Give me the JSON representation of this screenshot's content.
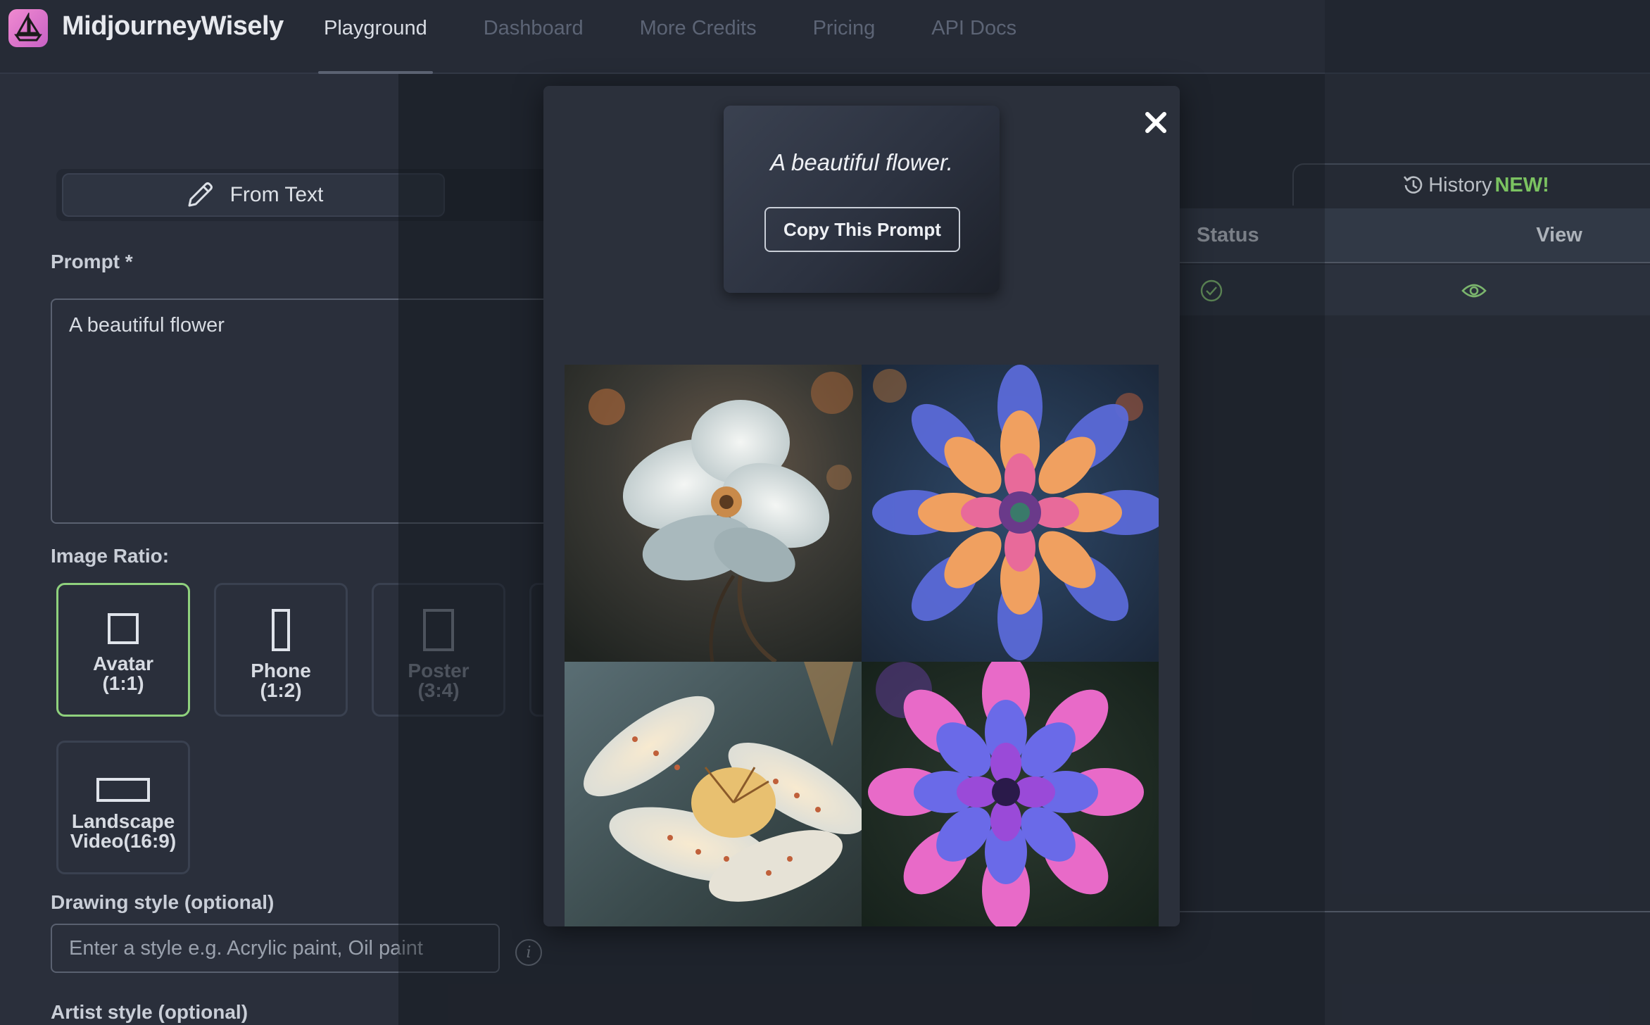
{
  "app": {
    "brand": "MidjourneyWisely",
    "nav": [
      "Playground",
      "Dashboard",
      "More Credits",
      "Pricing",
      "API Docs"
    ],
    "active_nav": "Playground"
  },
  "form": {
    "tab_label": "From Text",
    "prompt_label": "Prompt *",
    "prompt_value": "A beautiful flower",
    "ratio_label": "Image Ratio:",
    "ratios": [
      {
        "name": "Avatar",
        "ratio": "(1:1)",
        "selected": true
      },
      {
        "name": "Phone",
        "ratio": "(1:2)",
        "selected": false
      },
      {
        "name": "Poster",
        "ratio": "(3:4)",
        "selected": false
      },
      {
        "name": "Landscape",
        "ratio": "Video(16:9)",
        "selected": false
      }
    ],
    "drawing_style_label": "Drawing style (optional)",
    "drawing_style_placeholder": "Enter a style e.g. Acrylic paint, Oil paint",
    "artist_style_label": "Artist style (optional)"
  },
  "history": {
    "tab_label": "History",
    "tab_badge": "NEW!",
    "columns": [
      "Status",
      "View"
    ],
    "rows": [
      {
        "status": "check-icon",
        "view": "eye-icon"
      }
    ]
  },
  "modal": {
    "prompt_text": "A beautiful flower.",
    "copy_button_label": "Copy This Prompt",
    "images": [
      "white-wild-rose",
      "pastel-dahlia",
      "spotted-white-lily",
      "purple-dahlia"
    ]
  },
  "colors": {
    "accent_green": "#8fd17d",
    "badge_green": "#8fe06f",
    "background": "#2a2f3b",
    "logo_pink": "#e07ad0"
  }
}
